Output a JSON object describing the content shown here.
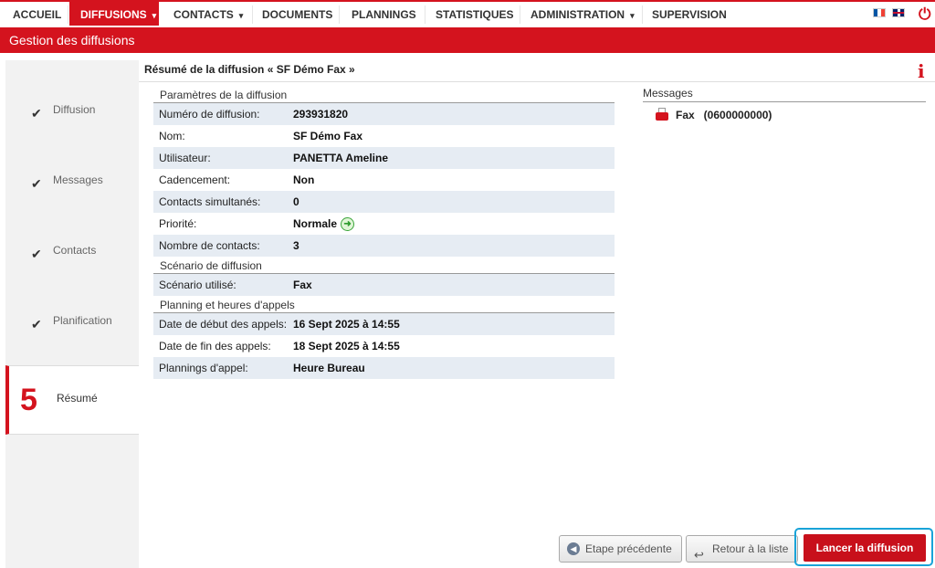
{
  "nav": {
    "items": [
      {
        "label": "ACCUEIL",
        "caret": ""
      },
      {
        "label": "DIFFUSIONS",
        "caret": "▾"
      },
      {
        "label": "CONTACTS",
        "caret": "▾"
      },
      {
        "label": "DOCUMENTS",
        "caret": ""
      },
      {
        "label": "PLANNINGS",
        "caret": ""
      },
      {
        "label": "STATISTIQUES",
        "caret": ""
      },
      {
        "label": "ADMINISTRATION",
        "caret": "▾"
      },
      {
        "label": "SUPERVISION",
        "caret": ""
      }
    ],
    "active": "DIFFUSIONS",
    "icons": [
      "flag-fr-icon",
      "flag-en-icon",
      "power-icon"
    ]
  },
  "header": {
    "title": "Gestion des diffusions"
  },
  "sidebar": {
    "steps": [
      {
        "label": "Diffusion",
        "done": true
      },
      {
        "label": "Messages",
        "done": true
      },
      {
        "label": "Contacts",
        "done": true
      },
      {
        "label": "Planification",
        "done": true
      },
      {
        "label": "Résumé",
        "number": "5",
        "current": true
      }
    ]
  },
  "main": {
    "title": "Résumé de la diffusion « SF Démo Fax »",
    "sections": {
      "params": "Paramètres de la diffusion",
      "scenario": "Scénario de diffusion",
      "planning": "Planning et heures d'appels"
    },
    "rows": {
      "numero": {
        "k": "Numéro de diffusion:",
        "v": "293931820"
      },
      "nom": {
        "k": "Nom:",
        "v": "SF Démo Fax"
      },
      "utilisateur": {
        "k": "Utilisateur:",
        "v": "PANETTA Ameline"
      },
      "cadencement": {
        "k": "Cadencement:",
        "v": "Non"
      },
      "contacts_simul": {
        "k": "Contacts simultanés:",
        "v": "0"
      },
      "priorite": {
        "k": "Priorité:",
        "v": "Normale"
      },
      "nb_contacts": {
        "k": "Nombre de contacts:",
        "v": "3"
      },
      "scenario": {
        "k": "Scénario utilisé:",
        "v": "Fax"
      },
      "debut": {
        "k": "Date de début des appels:",
        "v": "16 Sept 2025 à 14:55"
      },
      "fin": {
        "k": "Date de fin des appels:",
        "v": "18 Sept 2025 à 14:55"
      },
      "plannings": {
        "k": "Plannings d'appel:",
        "v": "Heure Bureau"
      }
    },
    "messages": {
      "heading": "Messages",
      "items": [
        {
          "text": "Fax   (0600000000)"
        }
      ]
    }
  },
  "buttons": {
    "prev": "Etape précédente",
    "back": "Retour à la liste",
    "launch": "Lancer la diffusion"
  },
  "colors": {
    "brand_red": "#d4131e",
    "highlight": "#19a3d8",
    "row_alt": "#e6ecf3"
  }
}
